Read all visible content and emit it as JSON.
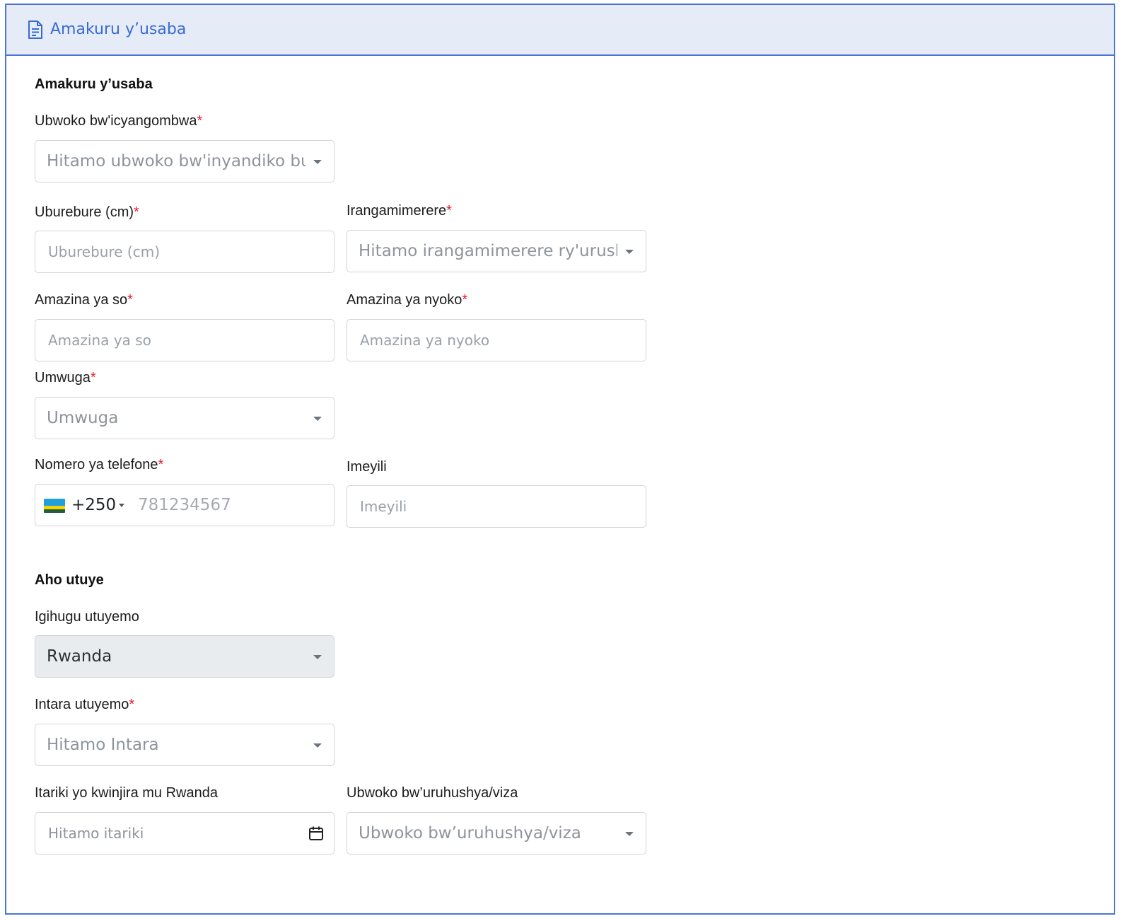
{
  "panel": {
    "title": "Amakuru y’usaba",
    "colors": {
      "accent": "#4b74d6",
      "header_bg": "#e5ecf8",
      "required_star": "#e11d2d"
    }
  },
  "applicant": {
    "section_title": "Amakuru y’usaba",
    "document_type": {
      "label": "Ubwoko bw'icyangombwa",
      "required": "*",
      "value": "Hitamo ubwoko bw'inyandiko bura"
    },
    "height": {
      "label": "Uburebure (cm)",
      "required": "*",
      "placeholder": "Uburebure (cm)"
    },
    "eye_color": {
      "label": "Irangamimerere",
      "required": "*",
      "value": "Hitamo irangamimerere ry'urushak"
    },
    "father_name": {
      "label": "Amazina ya so",
      "required": "*",
      "placeholder": "Amazina ya so"
    },
    "mother_name": {
      "label": "Amazina ya nyoko",
      "required": "*",
      "placeholder": "Amazina ya nyoko"
    },
    "occupation": {
      "label": "Umwuga",
      "required": "*",
      "value": "Umwuga"
    },
    "phone": {
      "label": "Nomero ya telefone",
      "required": "*",
      "dial_code": "+250",
      "placeholder": "781234567",
      "flag_icon": "rwanda-flag-icon"
    },
    "email": {
      "label": "Imeyili",
      "placeholder": "Imeyili"
    }
  },
  "residence": {
    "section_title": "Aho utuye",
    "country": {
      "label": "Igihugu utuyemo",
      "value": "Rwanda"
    },
    "province": {
      "label": "Intara utuyemo",
      "required": "*",
      "value": "Hitamo Intara"
    },
    "entry_date": {
      "label": "Itariki yo kwinjira mu Rwanda",
      "placeholder": "Hitamo itariki",
      "icon": "calendar-icon"
    },
    "visa_type": {
      "label": "Ubwoko bw’uruhushya/viza",
      "value": "Ubwoko bw’uruhushya/viza"
    }
  }
}
